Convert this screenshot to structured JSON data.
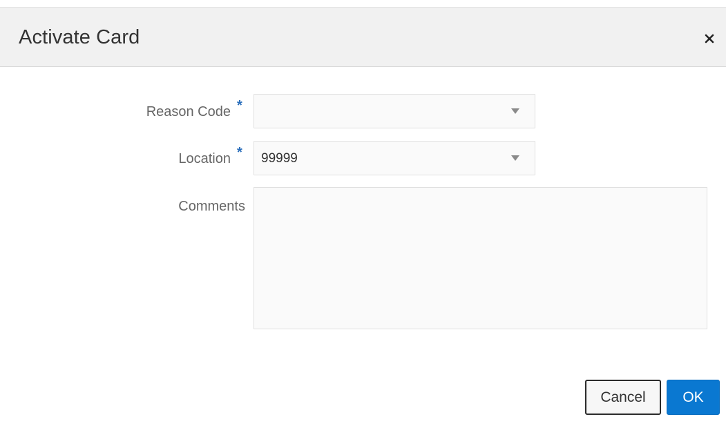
{
  "dialog": {
    "title": "Activate Card",
    "close_icon": "close-icon"
  },
  "form": {
    "reason_code": {
      "label": "Reason Code",
      "required_marker": "*",
      "value": ""
    },
    "location": {
      "label": "Location",
      "required_marker": "*",
      "value": "99999"
    },
    "comments": {
      "label": "Comments",
      "value": ""
    }
  },
  "buttons": {
    "cancel_label": "Cancel",
    "ok_label": "OK"
  },
  "colors": {
    "accent": "#0a78d1",
    "required": "#2a6ebb"
  }
}
